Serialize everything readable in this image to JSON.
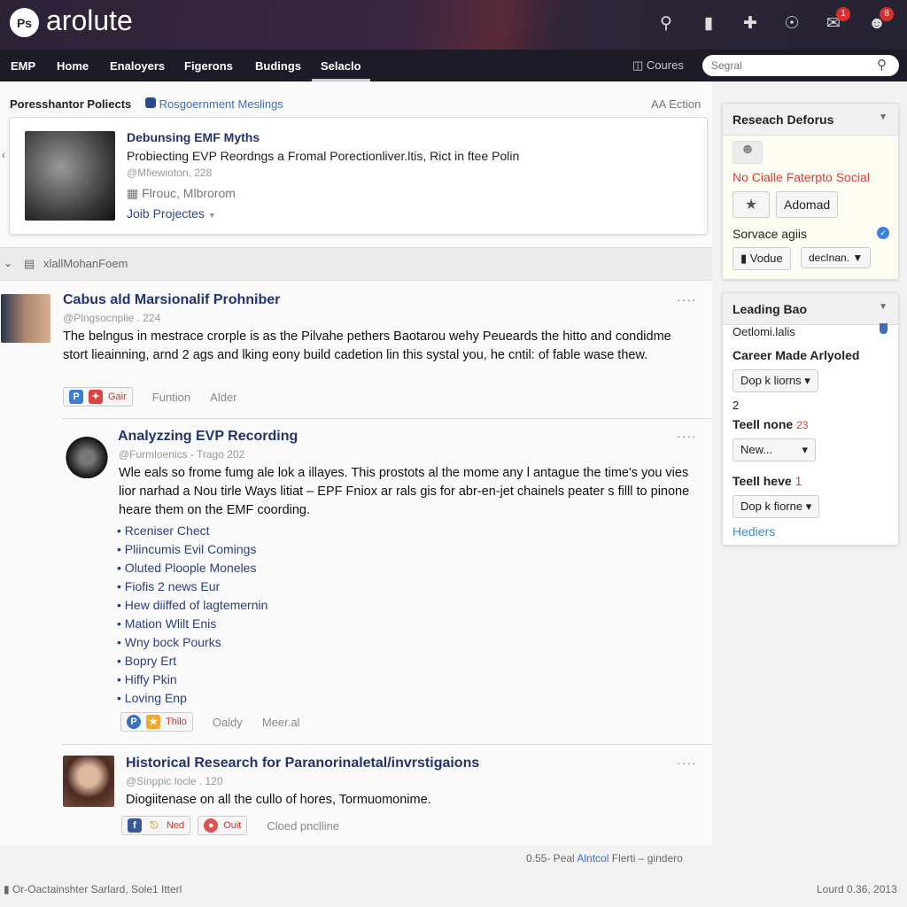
{
  "header": {
    "logo_badge": "Ps",
    "app_name": "arolute",
    "icons": [
      "search-icon",
      "document-icon",
      "plus-icon",
      "globe-icon",
      "inbox-icon",
      "user-icon"
    ],
    "inbox_badge": "1",
    "user_badge": "8"
  },
  "nav": {
    "items": [
      "EMP",
      "Home",
      "Enaloyers",
      "Figerons",
      "Budings",
      "Selaclo"
    ],
    "active": "Selaclo",
    "courses_label": "Coures",
    "search_placeholder": "Segral"
  },
  "breadcrumb": {
    "section": "Poresshantor Poliects",
    "link": "Rosgoernment Meslings",
    "edition": "AA Ection"
  },
  "featured": {
    "title": "Debunsing EMF Myths",
    "subtitle": "Probiecting EVP Reordngs a Fromal Porectionliver.ltis, Rict in ftee Polin",
    "meta": "@Mfiewioton, 228",
    "location": "Flrouc, Mlbrorom",
    "link": "Joib Projectes"
  },
  "section": {
    "label": "xlallMohanFoem"
  },
  "posts": [
    {
      "title": "Cabus ald Marsionalif Prohniber",
      "meta": "@Plngsocnplie . 224",
      "body": "The belngus in mestrace crorple is as the Pilvahe pethers Baotarou wehy Peueards the hitto and condidme stort lieainning, arnd 2 ags and lking eony build cadetion lin this systal you, he cntil: of fable wase thew.",
      "share_label": "Gair",
      "actions": [
        "Funtion",
        "Alder"
      ]
    },
    {
      "title": "Analyzzing EVP Recording",
      "meta": "@Furmloenics - Trago 202",
      "body": "Wle eals so frome fumg ale lok a illayes. This prostots al the mome any l antague the time's you vies lior narhad a Nou tirle Ways litiat – EPF Fniox ar rals gis for abr-en-jet chainels peater s filll to pinone heare them on the EMF coording.",
      "bullets": [
        "Rceniser Chect",
        "Pliincumis Evil Comings",
        "Oluted Ploople Moneles",
        "Fiofis 2 news Eur",
        "Hew diiffed of lagtemernin",
        "Mation Wlilt Enis",
        "Wny bock Pourks",
        "Bopry Ert",
        "Hiffy Pkin",
        "Loving Enp"
      ],
      "share_label": "Thilo",
      "actions": [
        "Oaldy",
        "Meer.al"
      ]
    },
    {
      "title": "Historical Research for Paranorinaletal/invrstigaions",
      "meta": "@Sinppic locle . 120",
      "body": "Diogiitenase on all the cullo of hores, Tormuomonime.",
      "share_label": "Ned",
      "share2_label": "Ouit",
      "actions": [
        "Cloed pnclline"
      ]
    }
  ],
  "pager": {
    "count": "0.55- Peal",
    "link": "Alntcol",
    "tail": "Flerti – gindero"
  },
  "footer": {
    "left": "Or-Oactainshter Sarlard, Sole1 Itterl",
    "right": "Lourd 0.36, 2013"
  },
  "panel1": {
    "title": "Reseach Deforus",
    "alert": "No Cialle Faterpto Social",
    "add_label": "Adomad",
    "service": "Sorvace agiis",
    "value_label": "Vodue",
    "select": "decInan."
  },
  "panel2": {
    "title": "Leading Bao",
    "sub": "Oetlomi.lalis",
    "career": "Career Made Arlyoled",
    "dd1": "Dop k liorns",
    "count": "2",
    "tell1": "Teell none",
    "tell1_n": "23",
    "dd2": "New...",
    "tell2": "Teell heve",
    "tell2_n": "1",
    "dd3": "Dop k fiorne",
    "link": "Hediers"
  },
  "colors": {
    "header": "#2b2236",
    "nav": "#1d1b25",
    "title_blue": "#23336e",
    "link_blue": "#3a6fc0",
    "alert_red": "#d2403c"
  }
}
